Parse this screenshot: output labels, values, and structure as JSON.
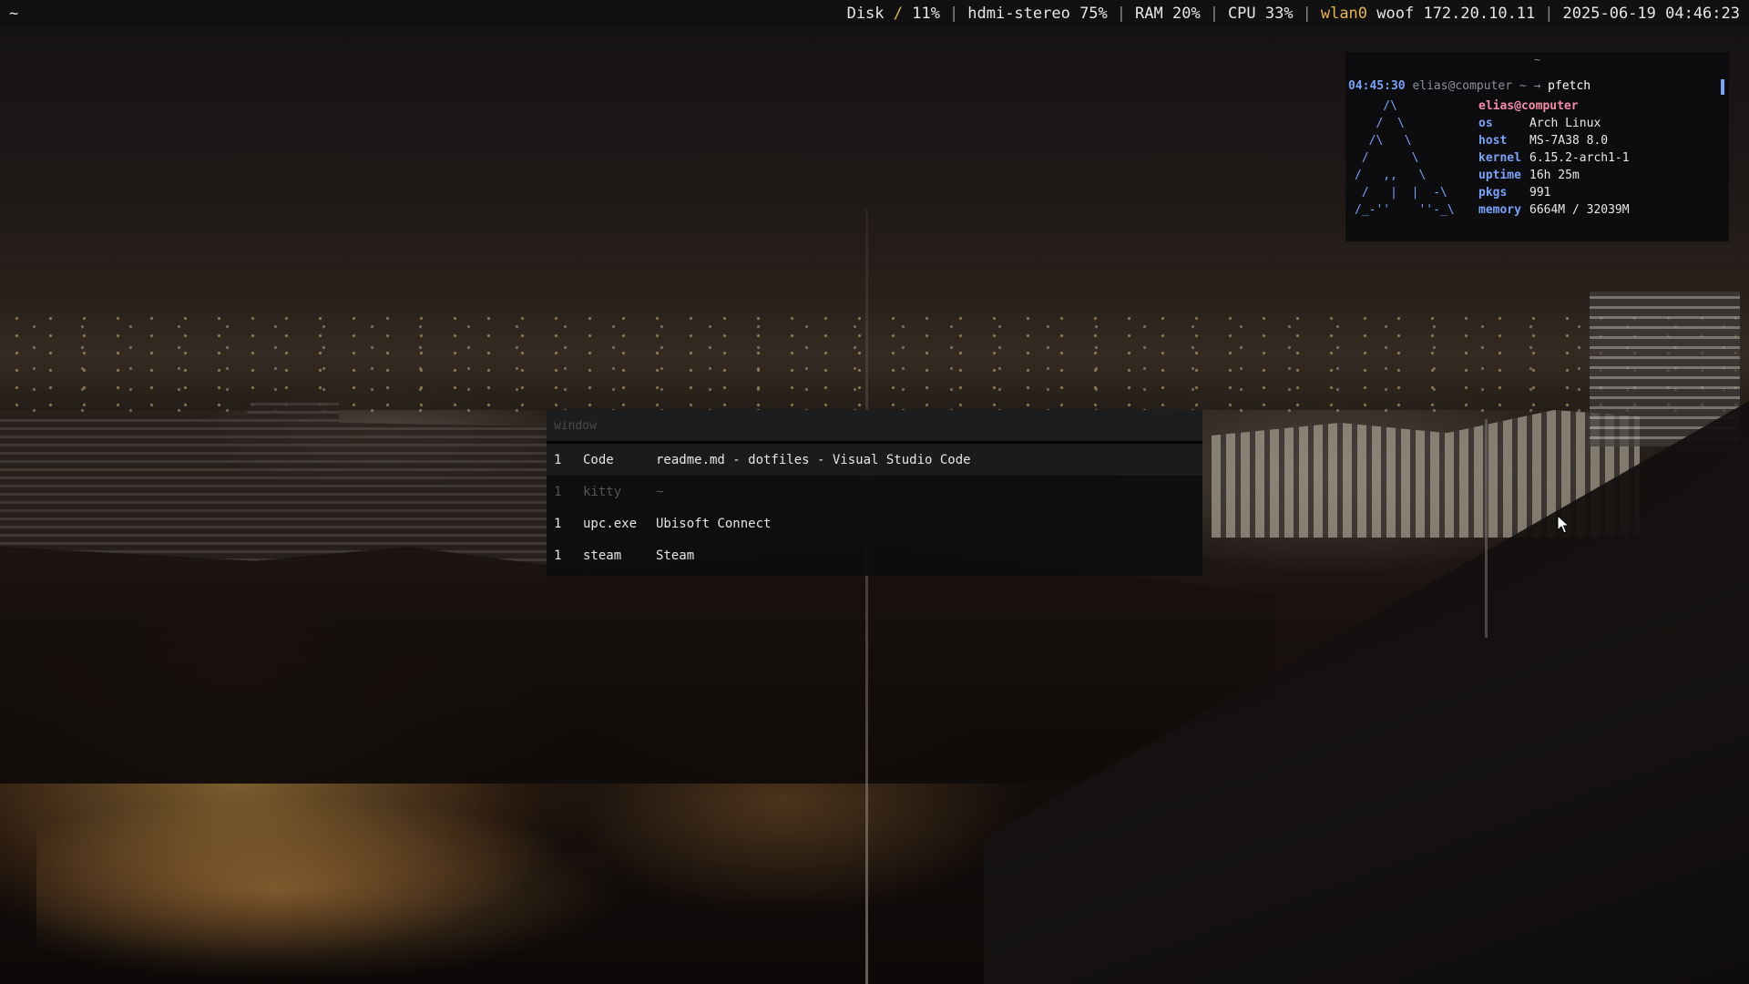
{
  "topbar": {
    "workspace": "~",
    "disk_label": "Disk",
    "disk_path": "/",
    "disk_value": "11%",
    "audio": "hdmi-stereo 75%",
    "ram": "RAM 20%",
    "cpu": "CPU 33%",
    "net_iface": "wlan0",
    "net_info": "woof 172.20.10.11",
    "datetime": "2025-06-19 04:46:23",
    "separator": "|"
  },
  "terminal": {
    "title": "~",
    "prompt_time": "04:45:30",
    "prompt_user": "elias@computer ~ →",
    "command": "pfetch",
    "logo_lines": [
      "    /\\",
      "   /  \\",
      "  /\\   \\",
      " /      \\",
      "/   ,,   \\",
      " /   |  |  -\\",
      "/_-''    ''-_\\"
    ],
    "pfetch": {
      "title": "elias@computer",
      "rows": [
        {
          "key": "os",
          "value": "Arch Linux"
        },
        {
          "key": "host",
          "value": "MS-7A38 8.0"
        },
        {
          "key": "kernel",
          "value": "6.15.2-arch1-1"
        },
        {
          "key": "uptime",
          "value": "16h 25m"
        },
        {
          "key": "pkgs",
          "value": "991"
        },
        {
          "key": "memory",
          "value": "6664M / 32039M"
        }
      ]
    }
  },
  "switcher": {
    "placeholder": "window",
    "rows": [
      {
        "workspace": "1",
        "class": "Code",
        "title": "readme.md - dotfiles - Visual Studio Code"
      },
      {
        "workspace": "1",
        "class": "kitty",
        "title": "~"
      },
      {
        "workspace": "1",
        "class": "upc.exe",
        "title": "Ubisoft Connect"
      },
      {
        "workspace": "1",
        "class": "steam",
        "title": "Steam"
      }
    ]
  },
  "colors": {
    "accent_blue": "#7aa2f7",
    "accent_pink": "#f38ba8",
    "net_highlight": "#e6b45a"
  }
}
